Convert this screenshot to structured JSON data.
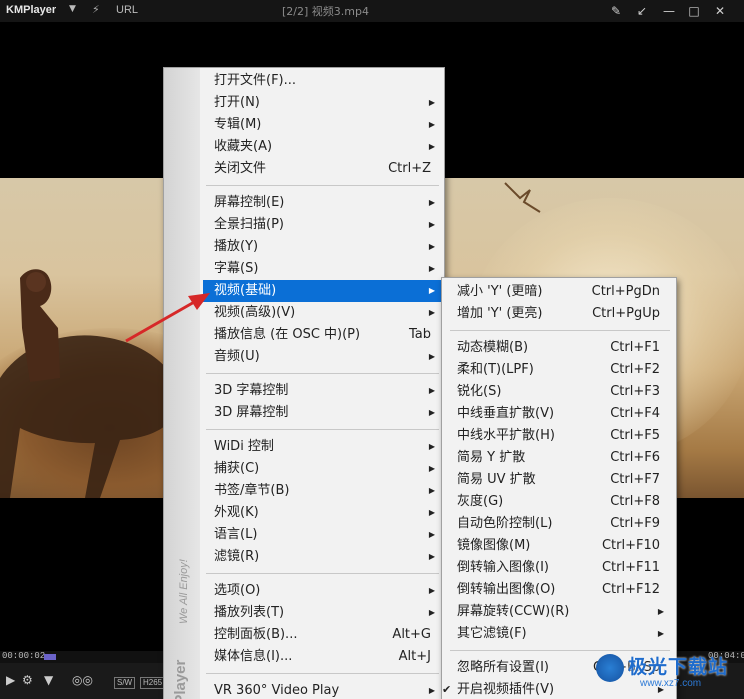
{
  "titlebar": {
    "app_name": "KMPlayer",
    "url_label": "URL",
    "file_title": "[2/2] 视频3.mp4"
  },
  "playback": {
    "current_time": "00:00:02",
    "duration": "00:04:0",
    "progress_fraction": 0.01,
    "tags": [
      "S/W",
      "H265"
    ]
  },
  "main_menu": {
    "brand_text": "KMPlayer",
    "brand_tagline": "We All Enjoy!",
    "items": [
      {
        "label": "打开文件(F)...",
        "shortcut": "",
        "submenu": false
      },
      {
        "label": "打开(N)",
        "shortcut": "",
        "submenu": true
      },
      {
        "label": "专辑(M)",
        "shortcut": "",
        "submenu": true
      },
      {
        "label": "收藏夹(A)",
        "shortcut": "",
        "submenu": true
      },
      {
        "label": "关闭文件",
        "shortcut": "Ctrl+Z",
        "submenu": false
      },
      {
        "label": "屏幕控制(E)",
        "shortcut": "",
        "submenu": true
      },
      {
        "label": "全景扫描(P)",
        "shortcut": "",
        "submenu": true
      },
      {
        "label": "播放(Y)",
        "shortcut": "",
        "submenu": true
      },
      {
        "label": "字幕(S)",
        "shortcut": "",
        "submenu": true
      },
      {
        "label": "视频(基础)",
        "shortcut": "",
        "submenu": true,
        "highlighted": true
      },
      {
        "label": "视频(高级)(V)",
        "shortcut": "",
        "submenu": true
      },
      {
        "label": "播放信息 (在 OSC 中)(P)",
        "shortcut": "Tab",
        "submenu": false
      },
      {
        "label": "音频(U)",
        "shortcut": "",
        "submenu": true
      },
      {
        "label": "3D 字幕控制",
        "shortcut": "",
        "submenu": true
      },
      {
        "label": "3D 屏幕控制",
        "shortcut": "",
        "submenu": true
      },
      {
        "label": "WiDi 控制",
        "shortcut": "",
        "submenu": true
      },
      {
        "label": "捕获(C)",
        "shortcut": "",
        "submenu": true
      },
      {
        "label": "书签/章节(B)",
        "shortcut": "",
        "submenu": true
      },
      {
        "label": "外观(K)",
        "shortcut": "",
        "submenu": true
      },
      {
        "label": "语言(L)",
        "shortcut": "",
        "submenu": true
      },
      {
        "label": "滤镜(R)",
        "shortcut": "",
        "submenu": true
      },
      {
        "label": "选项(O)",
        "shortcut": "",
        "submenu": true
      },
      {
        "label": "播放列表(T)",
        "shortcut": "",
        "submenu": true
      },
      {
        "label": "控制面板(B)...",
        "shortcut": "Alt+G",
        "submenu": false
      },
      {
        "label": "媒体信息(I)...",
        "shortcut": "Alt+J",
        "submenu": false
      },
      {
        "label": "VR 360° Video Play",
        "shortcut": "",
        "submenu": true
      }
    ]
  },
  "video_submenu": {
    "items": [
      {
        "label": "减小 'Y' (更暗)",
        "shortcut": "Ctrl+PgDn"
      },
      {
        "label": "增加 'Y' (更亮)",
        "shortcut": "Ctrl+PgUp"
      },
      {
        "label": "动态模糊(B)",
        "shortcut": "Ctrl+F1"
      },
      {
        "label": "柔和(T)(LPF)",
        "shortcut": "Ctrl+F2"
      },
      {
        "label": "锐化(S)",
        "shortcut": "Ctrl+F3"
      },
      {
        "label": "中线垂直扩散(V)",
        "shortcut": "Ctrl+F4"
      },
      {
        "label": "中线水平扩散(H)",
        "shortcut": "Ctrl+F5"
      },
      {
        "label": "简易 Y 扩散",
        "shortcut": "Ctrl+F6"
      },
      {
        "label": "简易 UV 扩散",
        "shortcut": "Ctrl+F7"
      },
      {
        "label": "灰度(G)",
        "shortcut": "Ctrl+F8"
      },
      {
        "label": "自动色阶控制(L)",
        "shortcut": "Ctrl+F9"
      },
      {
        "label": "镜像图像(M)",
        "shortcut": "Ctrl+F10"
      },
      {
        "label": "倒转输入图像(I)",
        "shortcut": "Ctrl+F11"
      },
      {
        "label": "倒转输出图像(O)",
        "shortcut": "Ctrl+F12"
      },
      {
        "label": "屏幕旋转(CCW)(R)",
        "shortcut": "",
        "submenu": true
      },
      {
        "label": "其它滤镜(F)",
        "shortcut": "",
        "submenu": true
      },
      {
        "label": "忽略所有设置(I)",
        "shortcut": "Ctrl+BkSp"
      },
      {
        "label": "开启视频插件(V)",
        "shortcut": "",
        "submenu": true,
        "checked": true
      }
    ]
  },
  "watermark": {
    "text": "极光下载站",
    "url": "www.xz7.com"
  },
  "colors": {
    "highlight": "#0b6fd6",
    "menu_bg": "#f2f2f2",
    "annotation_arrow": "#d62828"
  }
}
